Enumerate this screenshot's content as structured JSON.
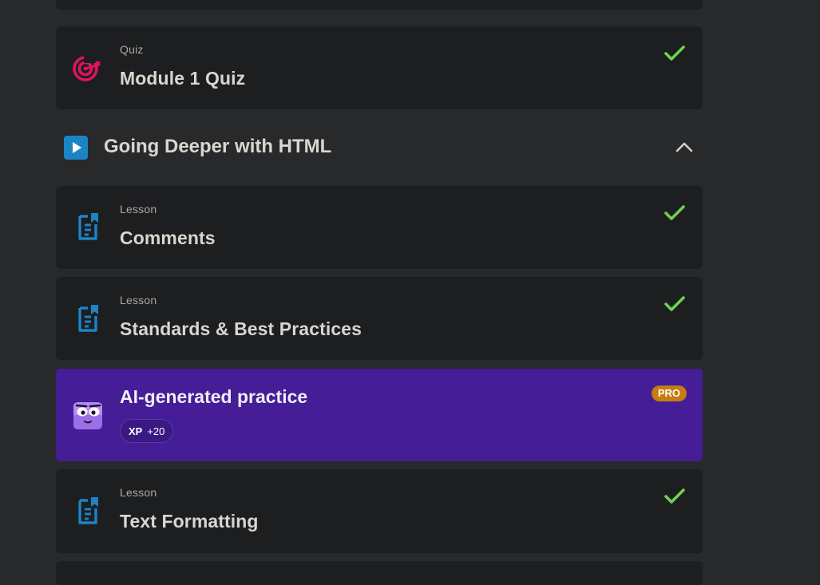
{
  "items": [
    {
      "kind": "Quiz",
      "title": "Module 1 Quiz",
      "completed": true,
      "icon": "target-icon"
    },
    {
      "kind": "Lesson",
      "title": "Comments",
      "completed": true,
      "icon": "document-icon"
    },
    {
      "kind": "Lesson",
      "title": "Standards & Best Practices",
      "completed": true,
      "icon": "document-icon"
    },
    {
      "kind": "Lesson",
      "title": "Text Formatting",
      "completed": true,
      "icon": "document-icon"
    }
  ],
  "section": {
    "title": "Going Deeper with HTML",
    "icon": "play-icon",
    "expanded": true
  },
  "ai_practice": {
    "title": "AI-generated practice",
    "badge": "PRO",
    "xp_label": "XP",
    "xp_value": "+20",
    "icon": "mascot-icon"
  },
  "colors": {
    "page_bg": "#27292b",
    "card_bg": "#1d1e20",
    "check": "#6fd14e",
    "quiz_icon": "#e2135b",
    "lesson_icon": "#1c84c6",
    "ai_bg": "#441d97",
    "pro_badge": "#c57d0d"
  }
}
